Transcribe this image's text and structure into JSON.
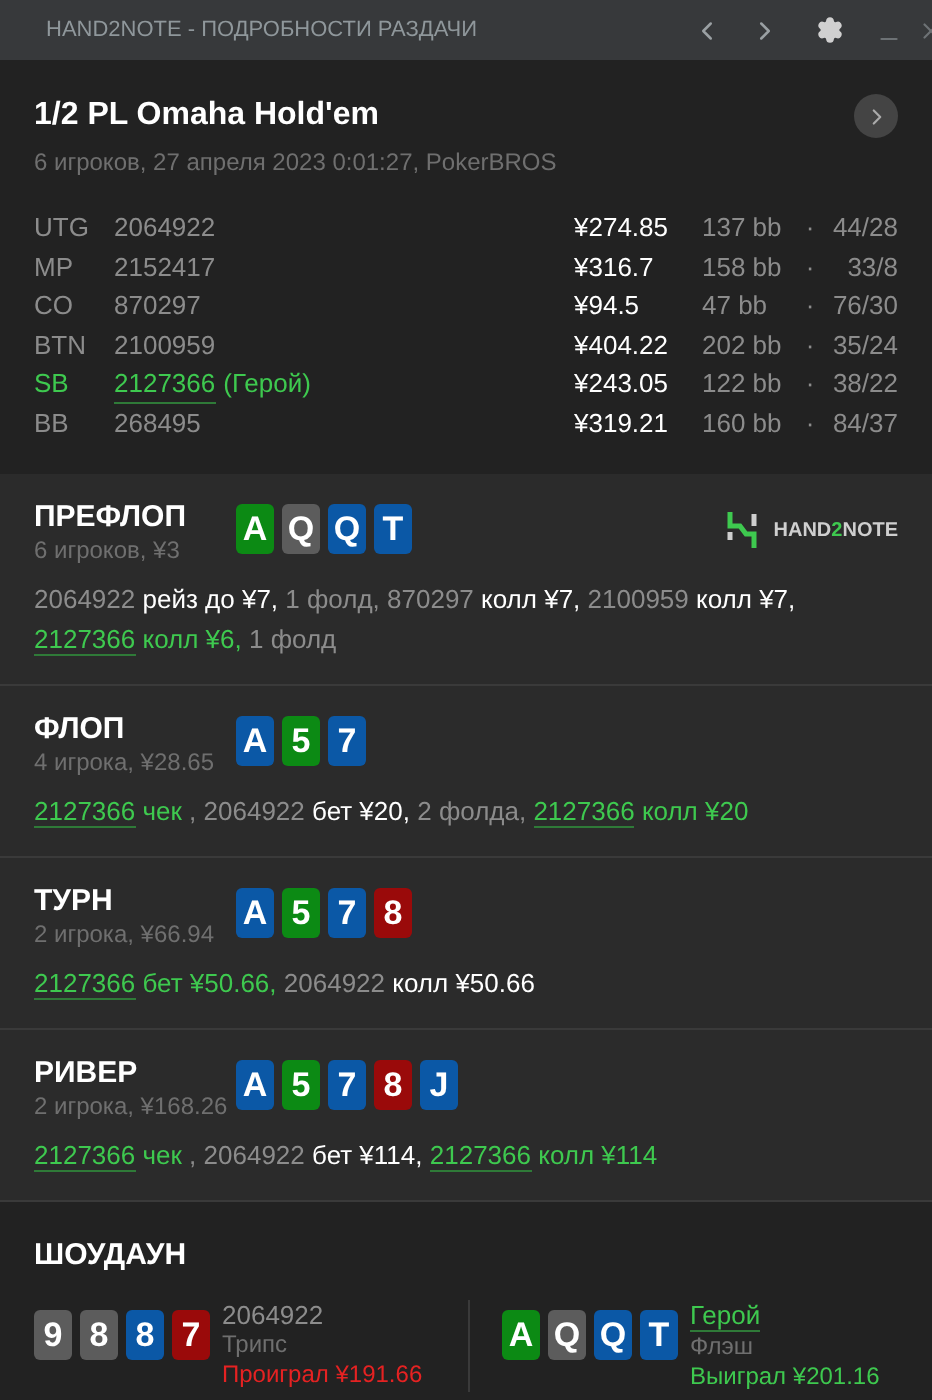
{
  "window": {
    "title": "HAND2NOTE - ПОДРОБНОСТИ РАЗДАЧИ"
  },
  "header": {
    "game": "1/2 PL Omaha Hold'em",
    "info": "6 игроков, 27 апреля 2023 0:01:27, PokerBROS"
  },
  "players": [
    {
      "position": "UTG",
      "name": "2064922",
      "hero": false,
      "stack": "¥274.85",
      "bb": "137 bb",
      "stats": "44/28"
    },
    {
      "position": "MP",
      "name": "2152417",
      "hero": false,
      "stack": "¥316.7",
      "bb": "158 bb",
      "stats": "33/8"
    },
    {
      "position": "CO",
      "name": "870297",
      "hero": false,
      "stack": "¥94.5",
      "bb": "47 bb",
      "stats": "76/30"
    },
    {
      "position": "BTN",
      "name": "2100959",
      "hero": false,
      "stack": "¥404.22",
      "bb": "202 bb",
      "stats": "35/24"
    },
    {
      "position": "SB",
      "name": "2127366",
      "hero": true,
      "hero_label": "(Герой)",
      "stack": "¥243.05",
      "bb": "122 bb",
      "stats": "38/22"
    },
    {
      "position": "BB",
      "name": "268495",
      "hero": false,
      "stack": "¥319.21",
      "bb": "160 bb",
      "stats": "84/37"
    }
  ],
  "separator": "·",
  "streets": [
    {
      "name": "ПРЕФЛОП",
      "info": "6 игроков, ¥3",
      "logo": [
        {
          "text": "HAND",
          "accent": false
        },
        {
          "text": "2",
          "accent": true
        },
        {
          "text": "NOTE",
          "accent": false
        }
      ],
      "cards": [
        {
          "rank": "A",
          "color": "#0c8a14"
        },
        {
          "rank": "Q",
          "color": "#5c5c5c"
        },
        {
          "rank": "Q",
          "color": "#0b58a6"
        },
        {
          "rank": "T",
          "color": "#0b58a6"
        }
      ],
      "lines": [
        [
          {
            "text": "2064922",
            "kind": "name"
          },
          {
            "text": " рейз до ¥7,",
            "kind": "move"
          },
          {
            "text": " 1 фолд,",
            "kind": "other"
          },
          {
            "text": " 870297",
            "kind": "name"
          },
          {
            "text": " колл ¥7,",
            "kind": "move"
          },
          {
            "text": " 2100959",
            "kind": "name"
          },
          {
            "text": " колл ¥7,",
            "kind": "move"
          }
        ],
        [
          {
            "text": "2127366",
            "kind": "hero_name"
          },
          {
            "text": " колл ¥6,",
            "kind": "hero_move"
          },
          {
            "text": " 1 фолд",
            "kind": "other"
          }
        ]
      ]
    },
    {
      "name": "ФЛОП",
      "info": "4 игрока, ¥28.65",
      "cards": [
        {
          "rank": "A",
          "color": "#0b58a6"
        },
        {
          "rank": "5",
          "color": "#0c8a14"
        },
        {
          "rank": "7",
          "color": "#0b58a6"
        }
      ],
      "lines": [
        [
          {
            "text": "2127366",
            "kind": "hero_name"
          },
          {
            "text": " чек ",
            "kind": "hero_move"
          },
          {
            "text": ", ",
            "kind": "other"
          },
          {
            "text": "2064922",
            "kind": "name"
          },
          {
            "text": " бет ¥20,",
            "kind": "move"
          },
          {
            "text": " 2 фолда, ",
            "kind": "other"
          },
          {
            "text": "2127366",
            "kind": "hero_name"
          },
          {
            "text": " колл ¥20",
            "kind": "hero_move"
          }
        ]
      ]
    },
    {
      "name": "ТУРН",
      "info": "2 игрока, ¥66.94",
      "cards": [
        {
          "rank": "A",
          "color": "#0b58a6"
        },
        {
          "rank": "5",
          "color": "#0c8a14"
        },
        {
          "rank": "7",
          "color": "#0b58a6"
        },
        {
          "rank": "8",
          "color": "#9a0a0a"
        }
      ],
      "lines": [
        [
          {
            "text": "2127366",
            "kind": "hero_name"
          },
          {
            "text": " бет ¥50.66,",
            "kind": "hero_move"
          },
          {
            "text": " 2064922",
            "kind": "name"
          },
          {
            "text": " колл ¥50.66",
            "kind": "move"
          }
        ]
      ]
    },
    {
      "name": "РИВЕР",
      "info": "2 игрока, ¥168.26",
      "cards": [
        {
          "rank": "A",
          "color": "#0b58a6"
        },
        {
          "rank": "5",
          "color": "#0c8a14"
        },
        {
          "rank": "7",
          "color": "#0b58a6"
        },
        {
          "rank": "8",
          "color": "#9a0a0a"
        },
        {
          "rank": "J",
          "color": "#0b58a6"
        }
      ],
      "lines": [
        [
          {
            "text": "2127366",
            "kind": "hero_name"
          },
          {
            "text": " чек ",
            "kind": "hero_move"
          },
          {
            "text": ", ",
            "kind": "other"
          },
          {
            "text": "2064922",
            "kind": "name"
          },
          {
            "text": " бет ¥114, ",
            "kind": "move"
          },
          {
            "text": "2127366",
            "kind": "hero_name"
          },
          {
            "text": " колл ¥114",
            "kind": "hero_move"
          }
        ]
      ]
    }
  ],
  "showdown": {
    "title": "ШОУДАУН",
    "hands": [
      {
        "player": "2064922",
        "hero": false,
        "hand": "Трипс",
        "result": "Проиграл ¥191.66",
        "won": false,
        "cards": [
          {
            "rank": "9",
            "color": "#5c5c5c"
          },
          {
            "rank": "8",
            "color": "#5c5c5c"
          },
          {
            "rank": "8",
            "color": "#0b58a6"
          },
          {
            "rank": "7",
            "color": "#9a0a0a"
          }
        ]
      },
      {
        "player": "Герой",
        "hero": true,
        "hand": "Флэш",
        "result": "Выиграл ¥201.16",
        "won": true,
        "cards": [
          {
            "rank": "A",
            "color": "#0c8a14"
          },
          {
            "rank": "Q",
            "color": "#5c5c5c"
          },
          {
            "rank": "Q",
            "color": "#0b58a6"
          },
          {
            "rank": "T",
            "color": "#0b58a6"
          }
        ]
      }
    ]
  }
}
